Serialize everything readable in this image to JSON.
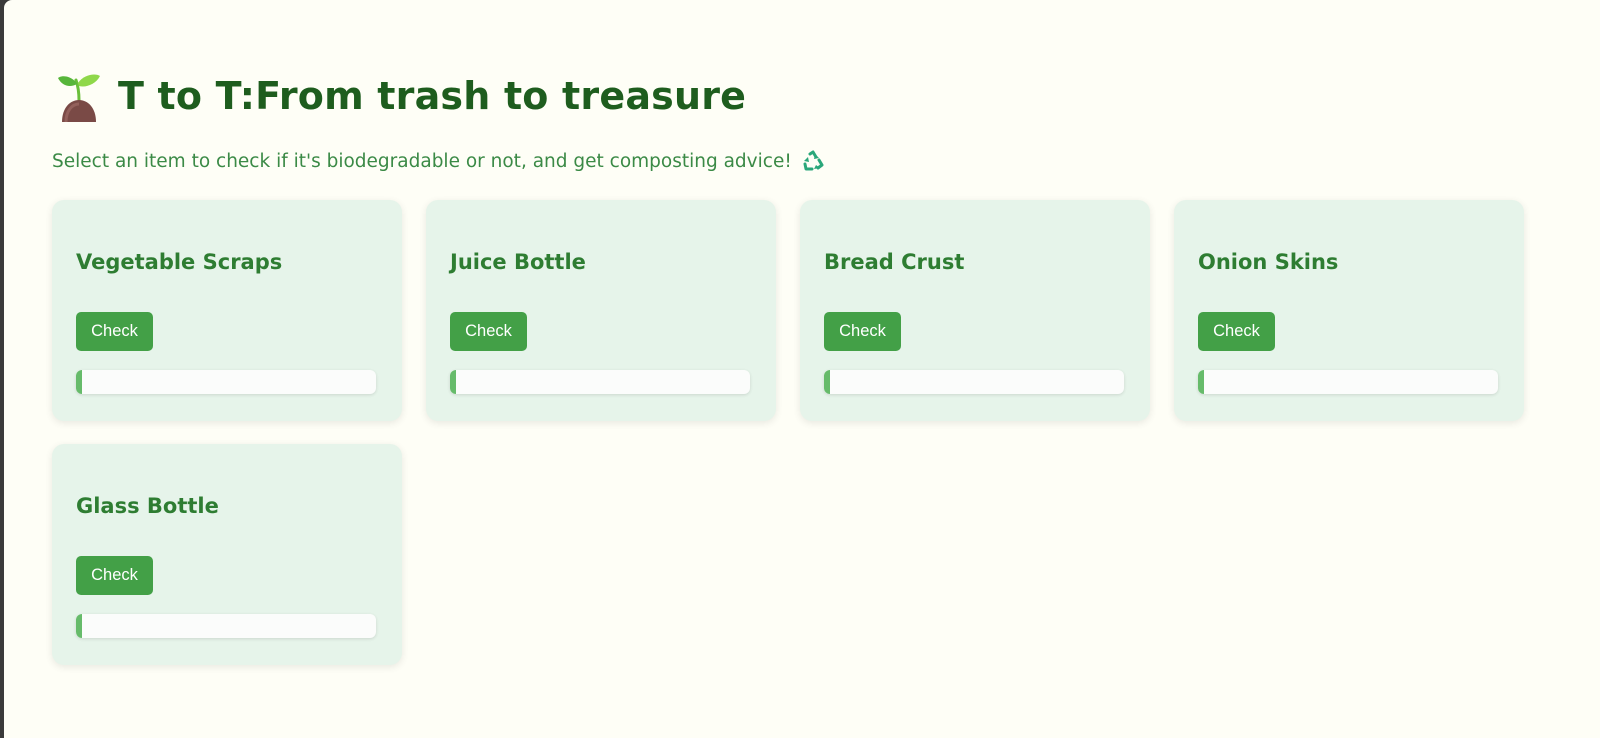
{
  "header": {
    "emoji_icon": "seedling-icon",
    "title": "T to T:From trash to treasure",
    "subtitle": "Select an item to check if it's biodegradable or not, and get composting advice!",
    "subtitle_icon": "recycle-icon"
  },
  "colors": {
    "page_bg": "#fefef6",
    "title": "#1e5d1e",
    "subtitle": "#3b8a46",
    "card_bg": "#e6f4ea",
    "card_title": "#2e7d32",
    "button": "#43a047",
    "progress_fill": "#66bb6a"
  },
  "items": [
    {
      "name": "Vegetable Scraps",
      "button_label": "Check",
      "progress_percent": 2
    },
    {
      "name": "Juice Bottle",
      "button_label": "Check",
      "progress_percent": 2
    },
    {
      "name": "Bread Crust",
      "button_label": "Check",
      "progress_percent": 2
    },
    {
      "name": "Onion Skins",
      "button_label": "Check",
      "progress_percent": 2
    },
    {
      "name": "Glass Bottle",
      "button_label": "Check",
      "progress_percent": 2
    }
  ]
}
